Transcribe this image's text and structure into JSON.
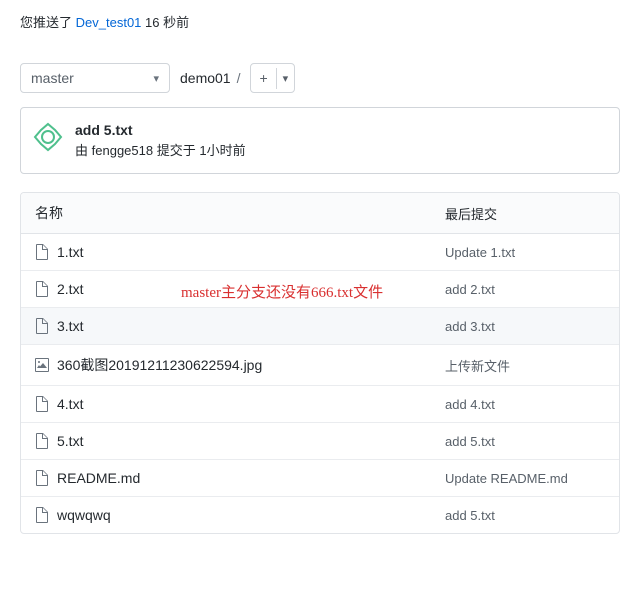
{
  "push_notice": {
    "prefix": "您推送了",
    "branch": "Dev_test01",
    "suffix": "16 秒前"
  },
  "branch_selector": {
    "value": "master"
  },
  "breadcrumb": {
    "repo": "demo01",
    "sep": "/"
  },
  "add_button": {
    "plus": "+"
  },
  "commit_card": {
    "title": "add 5.txt",
    "by_prefix": "由",
    "author": "fengge518",
    "verb": "提交于",
    "time": "1小时前"
  },
  "table": {
    "header_name": "名称",
    "header_commit": "最后提交",
    "rows": [
      {
        "name": "1.txt",
        "commit": "Update 1.txt",
        "icon": "file"
      },
      {
        "name": "2.txt",
        "commit": "add 2.txt",
        "icon": "file",
        "annotation": "master主分支还没有666.txt文件"
      },
      {
        "name": "3.txt",
        "commit": "add 3.txt",
        "icon": "file",
        "highlight": true
      },
      {
        "name": "360截图20191211230622594.jpg",
        "commit": "上传新文件",
        "icon": "image"
      },
      {
        "name": "4.txt",
        "commit": "add 4.txt",
        "icon": "file"
      },
      {
        "name": "5.txt",
        "commit": "add 5.txt",
        "icon": "file"
      },
      {
        "name": "README.md",
        "commit": "Update README.md",
        "icon": "file"
      },
      {
        "name": "wqwqwq",
        "commit": "add 5.txt",
        "icon": "file"
      }
    ]
  }
}
